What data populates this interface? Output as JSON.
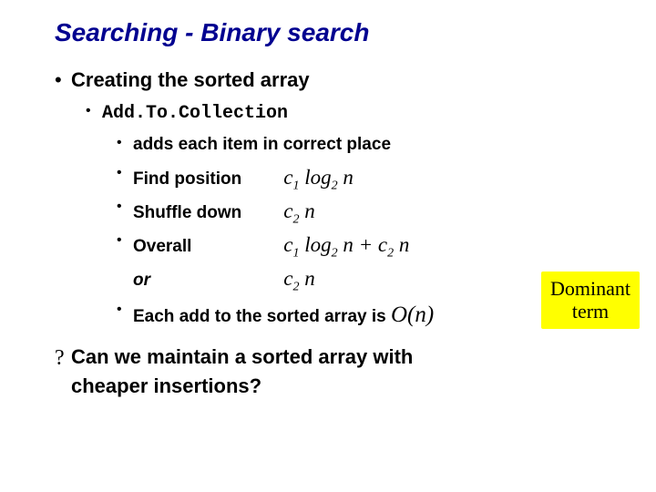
{
  "title": "Searching - Binary search",
  "l1": "Creating the sorted array",
  "l2": "Add.To.Collection",
  "l3a": "adds each item in correct place",
  "rows": {
    "find": {
      "label": "Find position",
      "formula_html": "c<span class='sub'>1</span> log<span class='sub'>2</span> n"
    },
    "shuffle": {
      "label": "Shuffle down",
      "formula_html": "c<span class='sub'>2</span> n"
    },
    "overall": {
      "label": "Overall",
      "formula_html": "c<span class='sub'>1</span> log<span class='sub'>2</span> n + c<span class='sub'>2</span>  n"
    },
    "or": {
      "label": "or",
      "formula_html": "c<span class='sub'>2</span>  n"
    }
  },
  "each_add_pre": "Each add to the sorted array is ",
  "each_add_O": "O(n)",
  "question": "Can we maintain a sorted array with cheaper insertions?",
  "callout_l1": "Dominant",
  "callout_l2": "term"
}
